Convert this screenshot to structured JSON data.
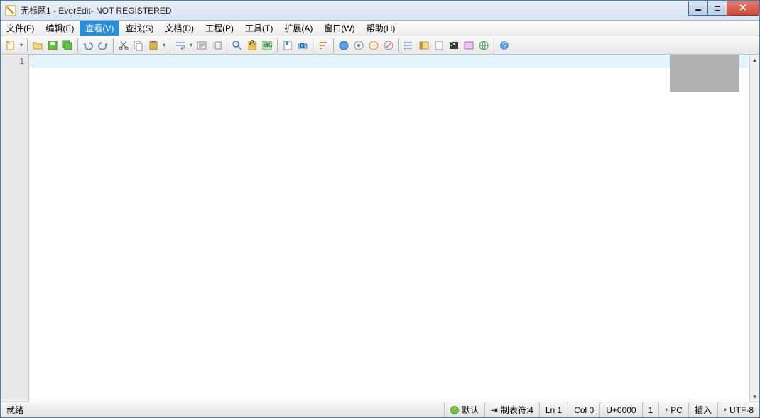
{
  "title": "无标题1 - EverEdit- NOT REGISTERED",
  "menu": {
    "file": "文件(F)",
    "edit": "编辑(E)",
    "view": "查看(V)",
    "search": "查找(S)",
    "document": "文档(D)",
    "project": "工程(P)",
    "tools": "工具(T)",
    "extend": "扩展(A)",
    "window": "窗口(W)",
    "help": "帮助(H)"
  },
  "editor": {
    "line_number": "1"
  },
  "status": {
    "ready": "就绪",
    "mode": "默认",
    "tabstop_label": "制表符:4",
    "line": "Ln 1",
    "col": "Col 0",
    "unicode": "U+0000",
    "page": "1",
    "lineend": "PC",
    "insert": "插入",
    "encoding": "UTF-8"
  }
}
